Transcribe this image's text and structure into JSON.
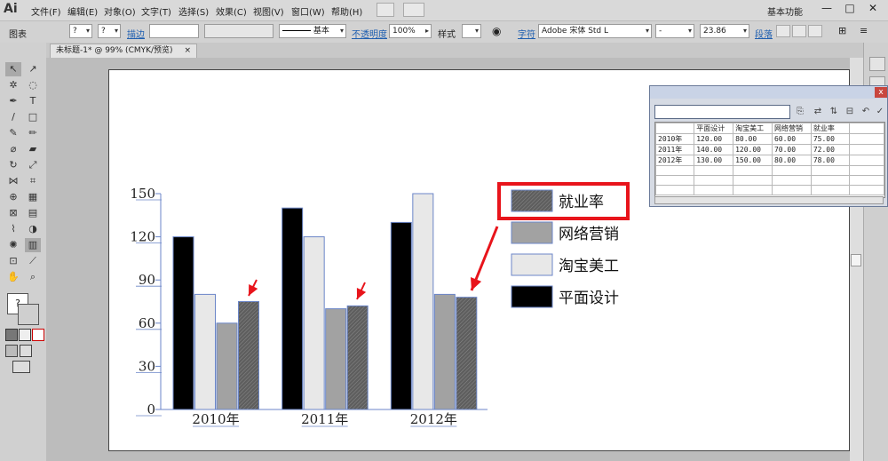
{
  "app": {
    "logo": "Ai",
    "menu": [
      "文件(F)",
      "编辑(E)",
      "对象(O)",
      "文字(T)",
      "选择(S)",
      "效果(C)",
      "视图(V)",
      "窗口(W)",
      "帮助(H)"
    ],
    "workspace": "基本功能",
    "window_buttons": [
      "—",
      "□",
      "✕"
    ]
  },
  "control_bar": {
    "object_type": "图表",
    "q1": "?",
    "q2": "?",
    "stroke_label": "描边",
    "stroke_style": "基本",
    "opacity_label": "不透明度",
    "opacity_value": "100%",
    "style_label": "样式",
    "char_label": "字符",
    "font_name": "Adobe 宋体 Std L",
    "font_style": "-",
    "font_size": "23.86",
    "para_label": "段落"
  },
  "document": {
    "tab_title": "未标题-1* @ 99% (CMYK/预览)",
    "tab_close": "×"
  },
  "data_panel": {
    "close": "x",
    "header": [
      "",
      "平面设计",
      "淘宝美工",
      "网络营销",
      "就业率"
    ],
    "rows": [
      [
        "2010年",
        "120.00",
        "80.00",
        "60.00",
        "75.00"
      ],
      [
        "2011年",
        "140.00",
        "120.00",
        "70.00",
        "72.00"
      ],
      [
        "2012年",
        "130.00",
        "150.00",
        "80.00",
        "78.00"
      ]
    ]
  },
  "chart_data": {
    "type": "bar",
    "categories": [
      "2010年",
      "2011年",
      "2012年"
    ],
    "series": [
      {
        "name": "平面设计",
        "values": [
          120,
          140,
          130
        ],
        "color": "#000000"
      },
      {
        "name": "淘宝美工",
        "values": [
          80,
          120,
          150
        ],
        "color": "#e8e8e8"
      },
      {
        "name": "网络营销",
        "values": [
          60,
          70,
          80
        ],
        "color": "#a2a2a2"
      },
      {
        "name": "就业率",
        "values": [
          75,
          72,
          78
        ],
        "color": "#6f6f6f"
      }
    ],
    "ylim": [
      0,
      150
    ],
    "yticks": [
      0,
      30,
      60,
      90,
      120,
      150
    ],
    "legend": "right",
    "highlighted_legend_entry": "就业率",
    "highlight_color": "#e8141b",
    "arrow_color": "#e8141b"
  }
}
